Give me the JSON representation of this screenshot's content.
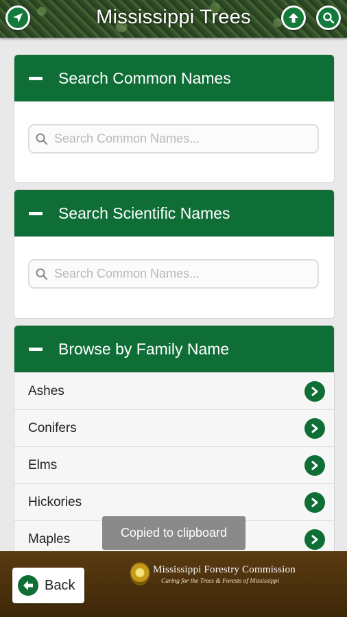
{
  "app": {
    "title": "Mississippi Trees"
  },
  "header": {
    "left_icon": "location-arrow-icon",
    "right_icons": [
      "up-arrow-icon",
      "search-icon"
    ]
  },
  "sections": [
    {
      "title": "Search Common Names",
      "placeholder": "Search Common Names..."
    },
    {
      "title": "Search Scientific Names",
      "placeholder": "Search Common Names..."
    },
    {
      "title": "Browse by Family Name",
      "items": [
        "Ashes",
        "Conifers",
        "Elms",
        "Hickories",
        "Maples"
      ]
    }
  ],
  "toast": {
    "text": "Copied to clipboard"
  },
  "footer": {
    "back_label": "Back",
    "org_name": "Mississippi Forestry Commission",
    "org_tagline": "Caring for the Trees & Forests of Mississippi"
  },
  "colors": {
    "brand_green": "#0f6e36",
    "footer_brown": "#4a300c"
  }
}
